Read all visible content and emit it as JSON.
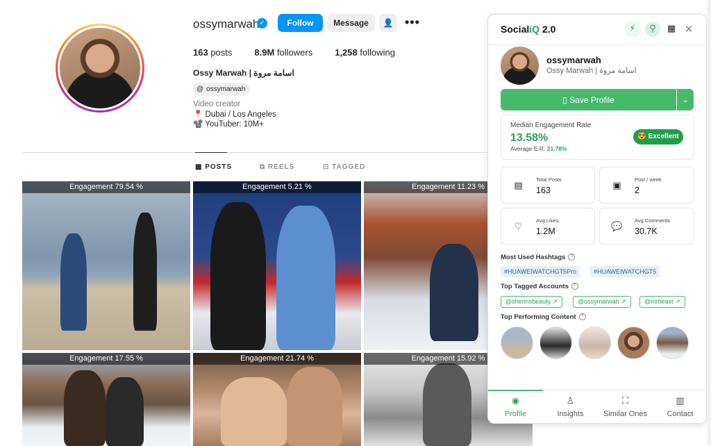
{
  "profile": {
    "username": "ossymarwah",
    "follow_label": "Follow",
    "message_label": "Message",
    "stats": {
      "posts": "163",
      "posts_label": "posts",
      "followers": "8.9M",
      "followers_label": "followers",
      "following": "1,258",
      "following_label": "following"
    },
    "full_name": "Ossy Marwah | اسامة مروة",
    "threads_handle": "ossymarwah",
    "bio_category": "Video creator",
    "bio_lines": [
      "📍 Dubai / Los Angeles",
      "📽️ YouTuber: 10M+"
    ]
  },
  "tabs": [
    "POSTS",
    "REELS",
    "TAGGED"
  ],
  "posts": [
    {
      "engagement": "Engagement 79.54 %"
    },
    {
      "engagement": "Engagement 5.21 %"
    },
    {
      "engagement": "Engagement 11.23 %"
    },
    {
      "engagement": "Engagement 17.55 %"
    },
    {
      "engagement": "Engagement 21.74 %"
    },
    {
      "engagement": "Engagement 15.92 %"
    }
  ],
  "panel": {
    "brand_main": "Social",
    "brand_iq": "iQ",
    "brand_version": " 2.0",
    "name": "ossymarwah",
    "subtitle": "Ossy Marwah | اسامة مروة",
    "save_label": "Save Profile",
    "engagement": {
      "label": "Median Engagement Rate",
      "value": "13.58%",
      "avg_label": "Average E.R: ",
      "avg_value": "21.78%",
      "badge": "😍 Excellent"
    },
    "stats": [
      {
        "label": "Total Posts",
        "value": "163",
        "icon": "calendar-icon"
      },
      {
        "label": "Post / week",
        "value": "2",
        "icon": "image-icon"
      },
      {
        "label": "Avg Likes",
        "value": "1.2M",
        "icon": "heart-icon"
      },
      {
        "label": "Avg Comments",
        "value": "30.7K",
        "icon": "comment-icon"
      }
    ],
    "hashtags_title": "Most Used Hashtags",
    "hashtags": [
      "#HUAWEIWATCHGT5Pro",
      "#HUAWEIWATCHGT5"
    ],
    "tagged_title": "Top Tagged Accounts",
    "tagged": [
      "@sherinsbeauty ↗",
      "@ossymarwah ↗",
      "@mrbeast ↗"
    ],
    "top_content_title": "Top Performing Content",
    "nav": [
      "Profile",
      "Insights",
      "Similar Ones",
      "Contact"
    ]
  },
  "colors": {
    "accent_green": "#46b96c",
    "instagram_blue": "#0095f6"
  }
}
